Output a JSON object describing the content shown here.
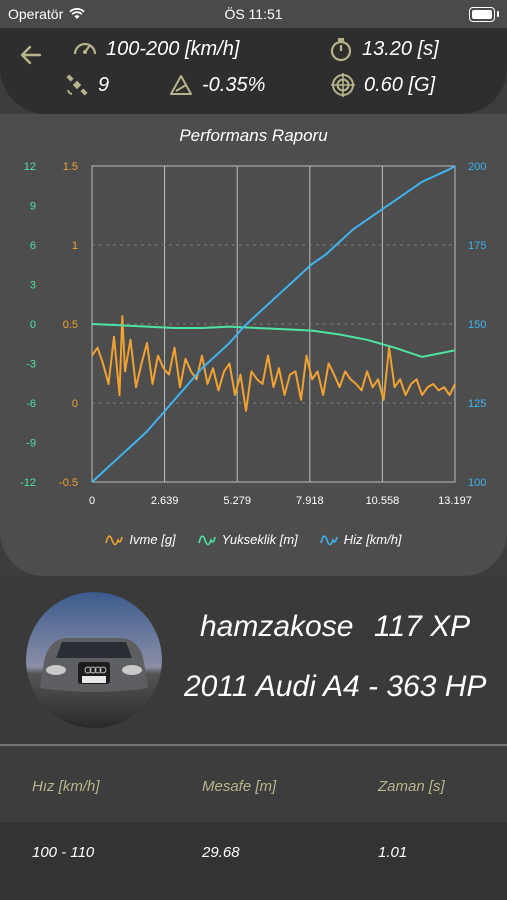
{
  "status": {
    "carrier": "Operatör",
    "time": "ÖS 11:51"
  },
  "header": {
    "speed_range": "100-200 [km/h]",
    "duration": "13.20 [s]",
    "satellites": "9",
    "slope": "-0.35%",
    "gforce": "0.60 [G]"
  },
  "chart_title": "Performans Raporu",
  "legend": {
    "accel": "Ivme [g]",
    "altitude": "Yukseklik [m]",
    "speed": "Hiz [km/h]"
  },
  "profile": {
    "username": "hamzakose",
    "xp": "117 XP",
    "car": "2011 Audi A4 - 363 HP"
  },
  "table": {
    "headers": [
      "Hız [km/h]",
      "Mesafe [m]",
      "Zaman [s]"
    ],
    "rows": [
      [
        "100 - 110",
        "29.68",
        "1.01"
      ]
    ]
  },
  "colors": {
    "accel": "#f0a232",
    "altitude": "#4fe3a3",
    "speed": "#3fb3f0",
    "header_label": "#b7b48c"
  },
  "chart_data": {
    "type": "line",
    "x_ticks": [
      "0",
      "2.639",
      "5.279",
      "7.918",
      "10.558",
      "13.197"
    ],
    "xlim": [
      0,
      13.197
    ],
    "y_left_outer_ticks": [
      "12",
      "9",
      "6",
      "3",
      "0",
      "-3",
      "-6",
      "-9",
      "-12"
    ],
    "y_left_inner_ticks": [
      "1.5",
      "1",
      "0.5",
      "0",
      "-0.5"
    ],
    "y_right_ticks": [
      "200",
      "175",
      "150",
      "125",
      "100"
    ],
    "series": [
      {
        "name": "Ivme [g]",
        "axis": "left_inner",
        "ylim": [
          -0.5,
          1.5
        ],
        "x": [
          0,
          0.2,
          0.4,
          0.6,
          0.8,
          1.0,
          1.1,
          1.2,
          1.4,
          1.6,
          1.8,
          2.0,
          2.2,
          2.4,
          2.6,
          2.8,
          3.0,
          3.2,
          3.4,
          3.6,
          3.8,
          4.0,
          4.2,
          4.4,
          4.6,
          4.8,
          5.0,
          5.2,
          5.4,
          5.6,
          5.8,
          6.0,
          6.2,
          6.4,
          6.6,
          6.8,
          7.0,
          7.2,
          7.4,
          7.6,
          7.8,
          8.0,
          8.2,
          8.4,
          8.6,
          8.8,
          9.0,
          9.2,
          9.4,
          9.6,
          9.8,
          10.0,
          10.2,
          10.4,
          10.6,
          10.8,
          11.0,
          11.2,
          11.4,
          11.6,
          11.8,
          12.0,
          12.2,
          12.4,
          12.6,
          12.8,
          13.0,
          13.197
        ],
        "y": [
          0.3,
          0.35,
          0.25,
          0.12,
          0.42,
          0.05,
          0.55,
          0.2,
          0.4,
          0.1,
          0.25,
          0.38,
          0.12,
          0.3,
          0.22,
          0.18,
          0.35,
          0.1,
          0.28,
          0.2,
          0.15,
          0.3,
          0.12,
          0.22,
          0.08,
          0.2,
          0.25,
          0.05,
          0.18,
          -0.05,
          0.2,
          0.15,
          0.12,
          0.3,
          0.1,
          0.22,
          0.05,
          0.18,
          0.2,
          0.02,
          0.3,
          0.15,
          0.2,
          0.05,
          0.25,
          0.18,
          0.1,
          0.2,
          0.15,
          0.12,
          0.08,
          0.2,
          0.1,
          0.15,
          0.02,
          0.35,
          0.1,
          0.15,
          0.05,
          0.12,
          0.15,
          0.05,
          0.1,
          0.12,
          0.08,
          0.1,
          0.05,
          0.12
        ]
      },
      {
        "name": "Yukseklik [m]",
        "axis": "left_outer",
        "ylim": [
          -12,
          12
        ],
        "x": [
          0,
          1,
          2,
          3,
          4,
          5,
          6,
          7,
          8,
          9,
          10,
          11,
          12,
          13.197
        ],
        "y": [
          0,
          -0.1,
          -0.2,
          -0.3,
          -0.3,
          -0.2,
          -0.3,
          -0.4,
          -0.5,
          -0.8,
          -1.2,
          -1.8,
          -2.5,
          -2
        ]
      },
      {
        "name": "Hiz [km/h]",
        "axis": "right",
        "ylim": [
          100,
          200
        ],
        "x": [
          0,
          0.5,
          1,
          1.5,
          2,
          2.5,
          3,
          3.5,
          4,
          4.5,
          5,
          5.5,
          6,
          6.5,
          7,
          7.5,
          8,
          8.5,
          9,
          9.5,
          10,
          10.5,
          11,
          11.5,
          12,
          12.5,
          13,
          13.197
        ],
        "y": [
          100,
          104,
          108,
          112,
          116,
          121,
          126,
          131,
          136,
          140,
          144,
          149,
          153,
          157,
          161,
          165,
          169,
          172,
          176,
          180,
          183,
          186,
          189,
          192,
          195,
          197,
          199,
          200
        ]
      }
    ]
  }
}
